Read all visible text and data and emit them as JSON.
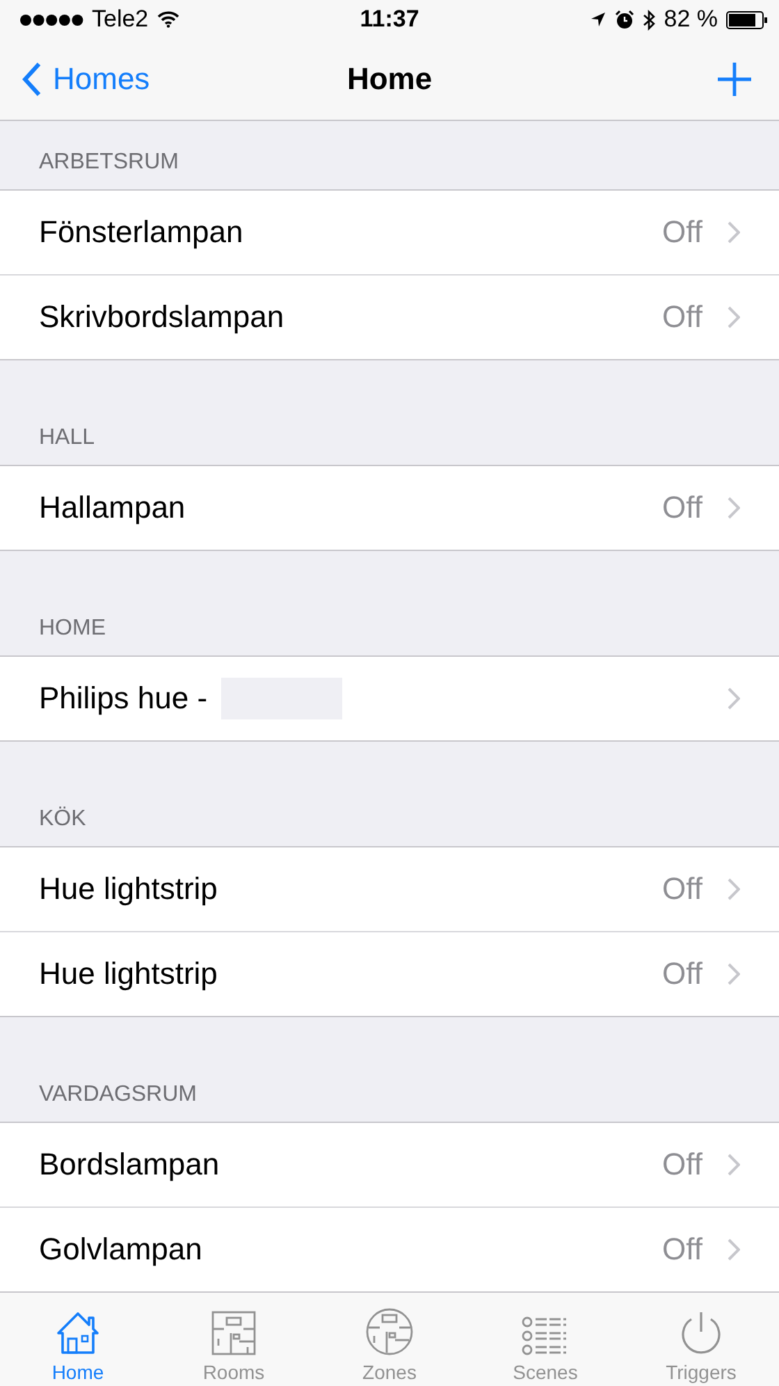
{
  "status_bar": {
    "carrier": "Tele2",
    "time": "11:37",
    "battery": "82 %"
  },
  "nav": {
    "back": "Homes",
    "title": "Home"
  },
  "sections": [
    {
      "header": "ARBETSRUM",
      "rows": [
        {
          "name": "Fönsterlampan",
          "state": "Off"
        },
        {
          "name": "Skrivbordslampan",
          "state": "Off"
        }
      ]
    },
    {
      "header": "HALL",
      "rows": [
        {
          "name": "Hallampan",
          "state": "Off"
        }
      ]
    },
    {
      "header": "HOME",
      "rows": [
        {
          "name": "Philips hue -",
          "redacted": true
        }
      ]
    },
    {
      "header": "KÖK",
      "rows": [
        {
          "name": "Hue lightstrip",
          "state": "Off"
        },
        {
          "name": "Hue lightstrip",
          "state": "Off"
        }
      ]
    },
    {
      "header": "VARDAGSRUM",
      "rows": [
        {
          "name": "Bordslampan",
          "state": "Off"
        },
        {
          "name": "Golvlampan",
          "state": "Off"
        }
      ]
    }
  ],
  "tabs": [
    {
      "label": "Home",
      "kind": "house",
      "selected": true
    },
    {
      "label": "Rooms",
      "kind": "floorplan",
      "selected": false
    },
    {
      "label": "Zones",
      "kind": "zone",
      "selected": false
    },
    {
      "label": "Scenes",
      "kind": "list",
      "selected": false
    },
    {
      "label": "Triggers",
      "kind": "power",
      "selected": false
    }
  ]
}
